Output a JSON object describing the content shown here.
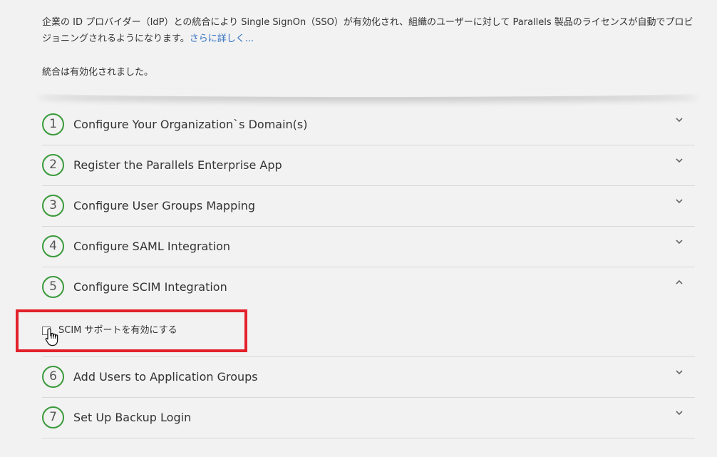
{
  "intro": {
    "description": "企業の ID プロバイダー（IdP）との統合により Single SignOn（SSO）が有効化され、組織のユーザーに対して Parallels 製品のライセンスが自動でプロビジョニングされるようになります。",
    "learn_more": "さらに詳しく...",
    "status": "統合は有効化されました。"
  },
  "steps": [
    {
      "number": "1",
      "title": "Configure Your Organization`s Domain(s)"
    },
    {
      "number": "2",
      "title": "Register the Parallels Enterprise App"
    },
    {
      "number": "3",
      "title": "Configure User Groups Mapping"
    },
    {
      "number": "4",
      "title": "Configure SAML Integration"
    },
    {
      "number": "5",
      "title": "Configure SCIM Integration",
      "checkbox_label": "SCIM サポートを有効にする"
    },
    {
      "number": "6",
      "title": "Add Users to Application Groups"
    },
    {
      "number": "7",
      "title": "Set Up Backup Login"
    }
  ],
  "colors": {
    "background": "#f2f2f2",
    "step_circle": "#3a9a3a",
    "link": "#2f6fc2",
    "highlight": "#e3212a"
  },
  "icons": {
    "collapsed": "chevron-down-icon",
    "expanded": "chevron-up-icon",
    "pointer": "hand-cursor-icon"
  }
}
